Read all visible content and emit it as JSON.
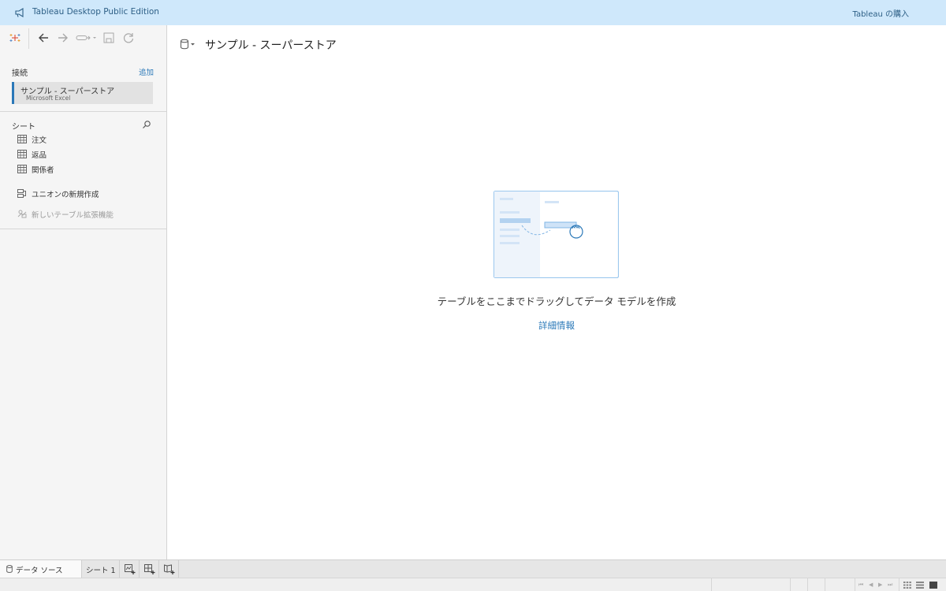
{
  "banner": {
    "title": "Tableau Desktop Public Edition",
    "buy_label": "Tableau の購入",
    "icon": "megaphone-icon"
  },
  "toolbar": {
    "icons": [
      "tableau-logo-icon",
      "back-icon",
      "forward-icon",
      "pause-updates-icon",
      "save-icon",
      "refresh-icon"
    ]
  },
  "connections": {
    "section_label": "接続",
    "add_label": "追加",
    "items": [
      {
        "name": "サンプル - スーパーストア",
        "type": "Microsoft Excel"
      }
    ]
  },
  "sheets": {
    "section_label": "シート",
    "items": [
      {
        "label": "注文",
        "icon": "table-icon"
      },
      {
        "label": "返品",
        "icon": "table-icon"
      },
      {
        "label": "関係者",
        "icon": "table-icon"
      }
    ],
    "new_union_label": "ユニオンの新規作成",
    "new_table_extension_label": "新しいテーブル拡張機能"
  },
  "main": {
    "datasource_name": "サンプル - スーパーストア",
    "empty_message": "テーブルをここまでドラッグしてデータ モデルを作成",
    "learn_more_label": "詳細情報"
  },
  "tabs": {
    "data_source_label": "データ ソース",
    "sheets": [
      "シート 1"
    ],
    "new_tab_icons": [
      "new-worksheet-icon",
      "new-dashboard-icon",
      "new-story-icon"
    ]
  },
  "colors": {
    "banner_bg": "#cfe8fb",
    "accent": "#2a78b8",
    "sidebar_bg": "#f5f5f5"
  }
}
